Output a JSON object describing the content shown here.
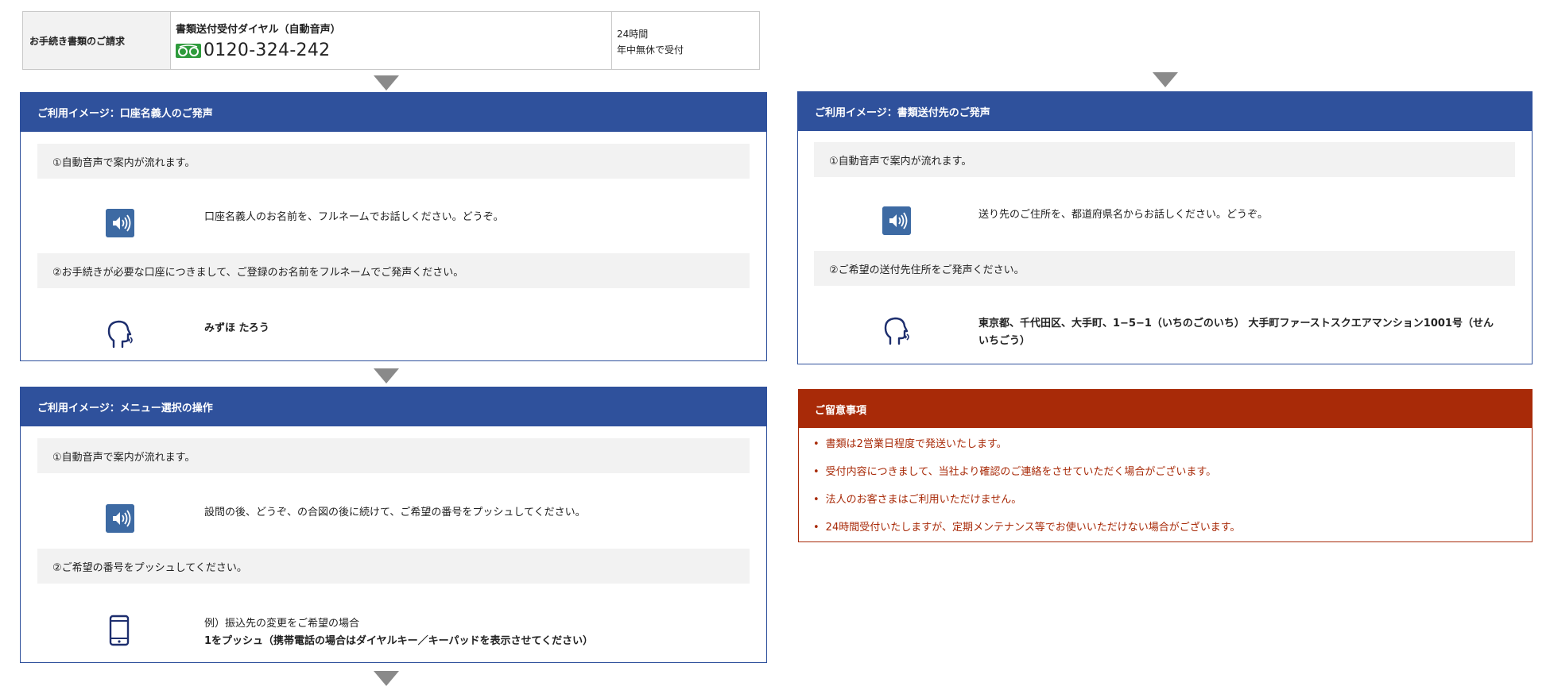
{
  "info_table": {
    "label": "お手続き書類のご請求",
    "dial_title": "書類送付受付ダイヤル（自動音声）",
    "phone": "0120-324-242",
    "hours_line1": "24時間",
    "hours_line2": "年中無休で受付"
  },
  "panel_name": {
    "title": "ご利用イメージ：口座名義人のご発声",
    "step1": "①自動音声で案内が流れます。",
    "voice_text": "口座名義人のお名前を、フルネームでお話しください。どうぞ。",
    "step2": "②お手続きが必要な口座につきまして、ご登録のお名前をフルネームでご発声ください。",
    "answer": "みずほ たろう"
  },
  "panel_menu": {
    "title": "ご利用イメージ：メニュー選択の操作",
    "step1": "①自動音声で案内が流れます。",
    "voice_text": "設問の後、どうぞ、の合図の後に続けて、ご希望の番号をプッシュしてください。",
    "step2": "②ご希望の番号をプッシュしてください。",
    "example_line1": "例）振込先の変更をご希望の場合",
    "example_line2": "1をプッシュ（携帯電話の場合はダイヤルキー／キーパッドを表示させてください）"
  },
  "panel_address": {
    "title": "ご利用イメージ：書類送付先のご発声",
    "step1": "①自動音声で案内が流れます。",
    "voice_text": "送り先のご住所を、都道府県名からお話しください。どうぞ。",
    "step2": "②ご希望の送付先住所をご発声ください。",
    "answer_line1": "東京都、千代田区、大手町、1−5−1（いちのごのいち） 大手町ファーストスクエアマンション1001号（せん",
    "answer_line2": "いちごう）"
  },
  "notes": {
    "title": "ご留意事項",
    "items": [
      "書類は2営業日程度で発送いたします。",
      "受付内容につきまして、当社より確認のご連絡をさせていただく場合がございます。",
      "法人のお客さまはご利用いただけません。",
      "24時間受付いたしますが、定期メンテナンス等でお使いいただけない場合がございます。"
    ]
  },
  "icons": [
    "freedial-icon",
    "speaker-icon",
    "speaking-head-icon",
    "smartphone-icon",
    "arrow-down-icon"
  ],
  "colors": {
    "panel_blue": "#2f519c",
    "note_red": "#a82a08",
    "step_gray": "#f2f2f2",
    "freedial_green": "#2e9b3c"
  }
}
